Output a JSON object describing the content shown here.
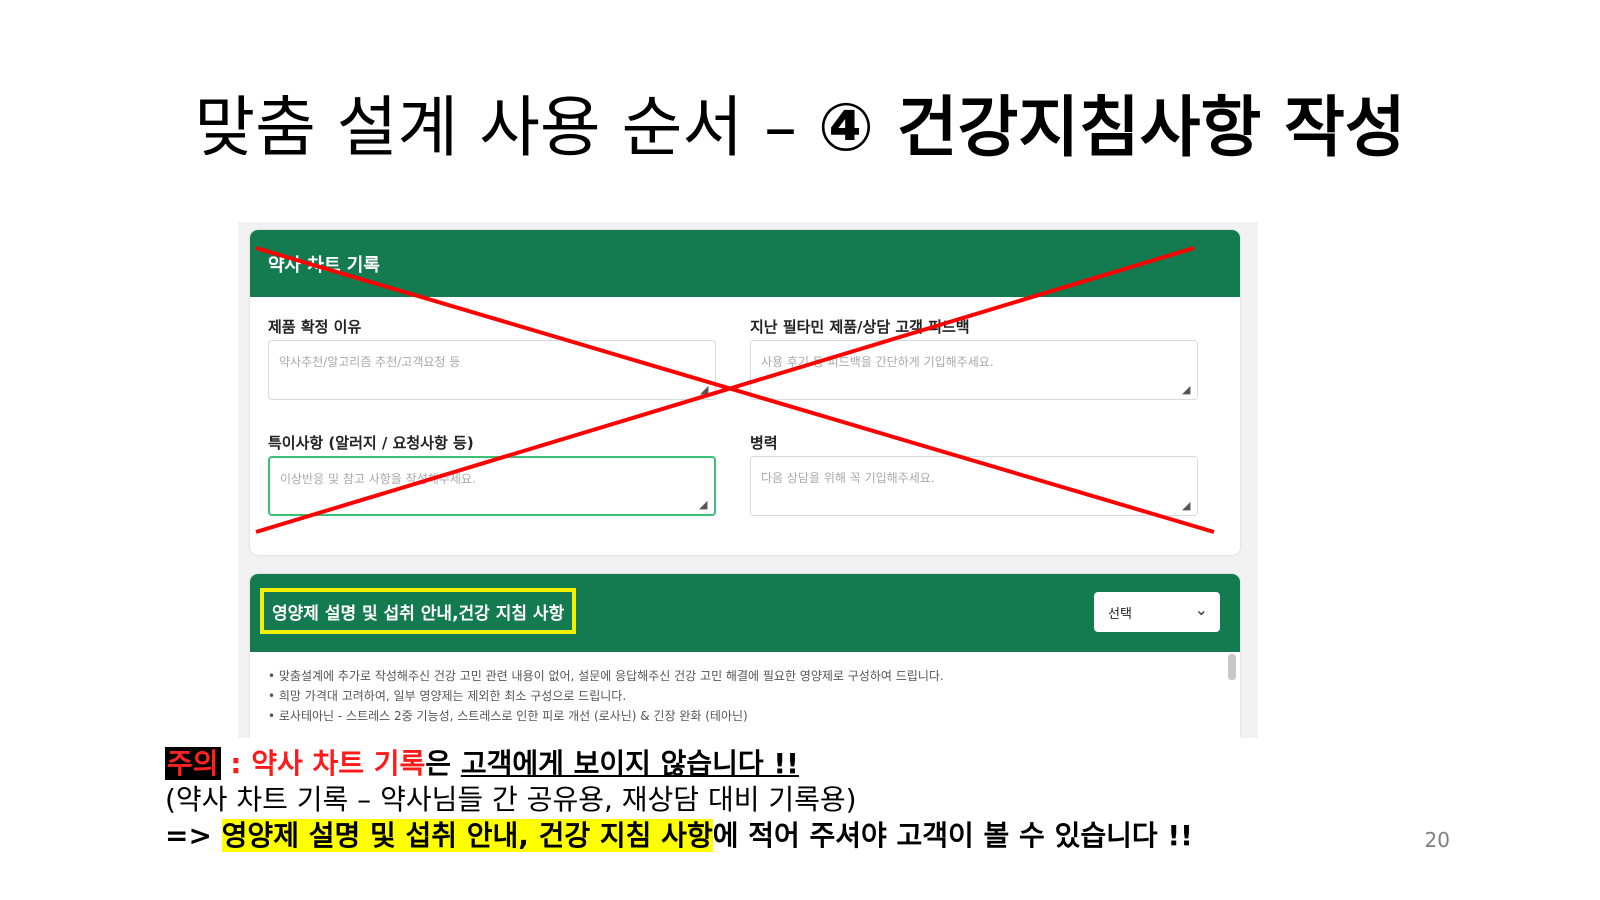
{
  "slide": {
    "title_normal": "맞춤 설계 사용 순서 – ",
    "title_bold": "④ 건강지침사항 작성",
    "page_number": "20"
  },
  "screenshot": {
    "chart_record": {
      "header": "약사 차트 기록",
      "fields": [
        {
          "label": "제품 확정 이유",
          "placeholder": "약사추천/알고리즘 추천/고객요청 등"
        },
        {
          "label": "지난 필타민 제품/상담 고객 피드백",
          "placeholder": "사용 후기 등 피드백을 간단하게 기입해주세요."
        },
        {
          "label": "특이사항 (알러지 / 요청사항 등)",
          "placeholder": "이상반응 및 참고 사항을 작성해주세요."
        },
        {
          "label": "병력",
          "placeholder": "다음 상담을 위해 꼭 기입해주세요."
        }
      ]
    },
    "guide": {
      "header": "영양제 설명 및 섭취 안내,건강 지침 사항",
      "select_value": "선택",
      "notes": [
        "• 맞춤설계에 추가로 작성해주신 건강 고민 관련 내용이 없어, 설문에 응답해주신 건강 고민 해결에 필요한 영양제로 구성하여 드립니다.",
        "• 희망 가격대 고려하여, 일부 영양제는 제외한 최소 구성으로 드립니다.",
        "• 로사테아닌 - 스트레스 2중 기능성, 스트레스로 인한 피로 개선 (로사닌) & 긴장 완화 (테아닌)"
      ]
    }
  },
  "notice": {
    "tag": "주의",
    "colon": " : ",
    "red_text": "약사 차트 기록",
    "eun": "은 ",
    "underline_text": "고객에게 보이지 않습니다 !!",
    "line2": "(약사 차트 기록 – 약사님들 간 공유용, 재상담 대비 기록용)",
    "line3_prefix": "=> ",
    "line3_highlight": "영양제 설명 및 섭취 안내, 건강 지침 사항",
    "line3_suffix": "에 적어 주셔야 고객이 볼 수 있습니다 !!"
  },
  "colors": {
    "header_green": "#147a4f",
    "cross_red": "#ff0000",
    "highlight_yellow": "#ffff00"
  }
}
